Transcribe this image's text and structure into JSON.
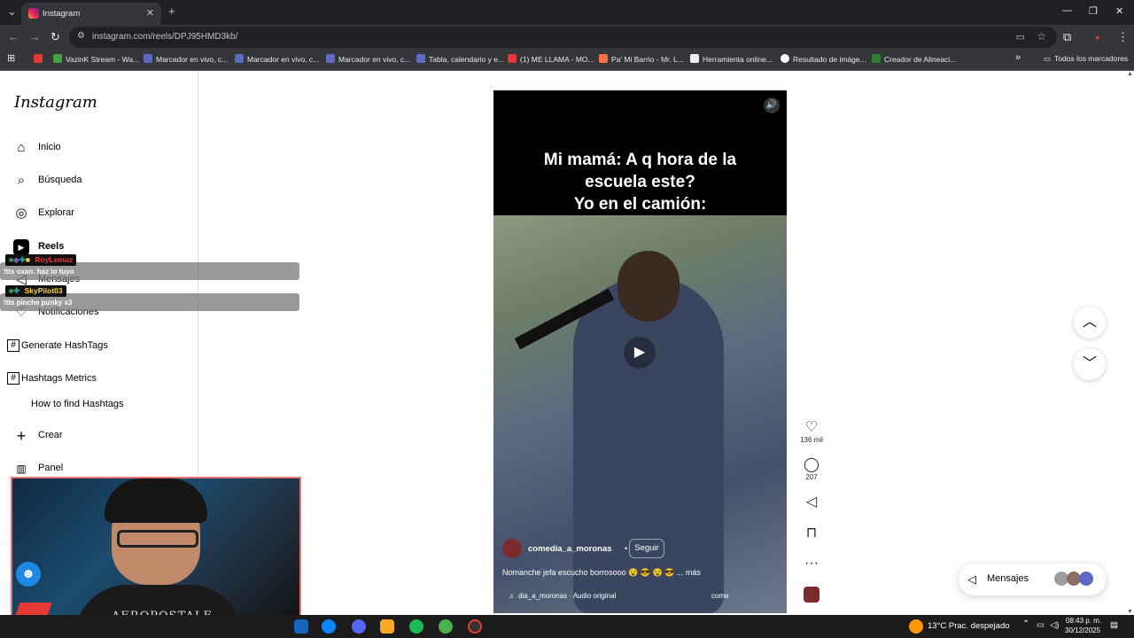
{
  "browser": {
    "tab_title": "Instagram",
    "url": "instagram.com/reels/DPJ95HMD3kb/",
    "bookmarks": [
      "VazinK Stream - Wa...",
      "Marcador en vivo, c...",
      "Marcador en vivo, c...",
      "Marcador en vivo, c...",
      "Tabla, calendario y e...",
      "(1) ME LLAMA - MO...",
      "Pa' Mi Barrio - Mr. L...",
      "Herramienta online...",
      "Resultado de imáge...",
      "Creador de Alineaci..."
    ],
    "all_bookmarks": "Todos los marcadores"
  },
  "sidebar": {
    "logo": "Instagram",
    "items": [
      {
        "label": "Inicio",
        "icon": "home-icon"
      },
      {
        "label": "Búsqueda",
        "icon": "search-icon"
      },
      {
        "label": "Explorar",
        "icon": "compass-icon"
      },
      {
        "label": "Reels",
        "icon": "reels-icon"
      },
      {
        "label": "Mensajes",
        "icon": "messages-icon"
      },
      {
        "label": "Notificaciones",
        "icon": "heart-icon"
      },
      {
        "label": "Generate HashTags",
        "icon": "hashtag-icon"
      },
      {
        "label": "Hashtags Metrics",
        "icon": "hashtag-icon"
      },
      {
        "label": "How to find Hashtags",
        "icon": ""
      },
      {
        "label": "Crear",
        "icon": "plus-icon"
      },
      {
        "label": "Panel",
        "icon": "chart-icon"
      }
    ]
  },
  "chat": [
    {
      "user": "RoyLemuz",
      "message": "!tts oxan. haz lo tuyo",
      "name_color": "#e53935"
    },
    {
      "user": "SkyPilot03",
      "message": "!tts pinche punky x3",
      "name_color": "#fdd835"
    }
  ],
  "webcam": {
    "shirt_text": "AEROPOSTALE"
  },
  "reel": {
    "caption_lines": [
      "Mi mamá: A q hora de la",
      "escuela este?",
      "Yo en el camión:"
    ],
    "username": "comedia_a_moronas",
    "follow_label": "Seguir",
    "description": "Nomanche jefa escucho borrosooo 😵 😎 😵 😎 ... más",
    "audio": "dia_a_moronas · Audio original",
    "audio_tag": "come"
  },
  "actions": {
    "likes": "136 mil",
    "comments": "207"
  },
  "messages_pill": {
    "label": "Mensajes"
  },
  "taskbar": {
    "weather": "13°C  Prac. despejado",
    "time": "08:43 p. m.",
    "date": "30/12/2025"
  },
  "colors": {
    "chrome_dark": "#202124",
    "chrome_mid": "#35363a",
    "instagram_border": "#dbdbdb",
    "taskbar": "#1c1c1c"
  }
}
